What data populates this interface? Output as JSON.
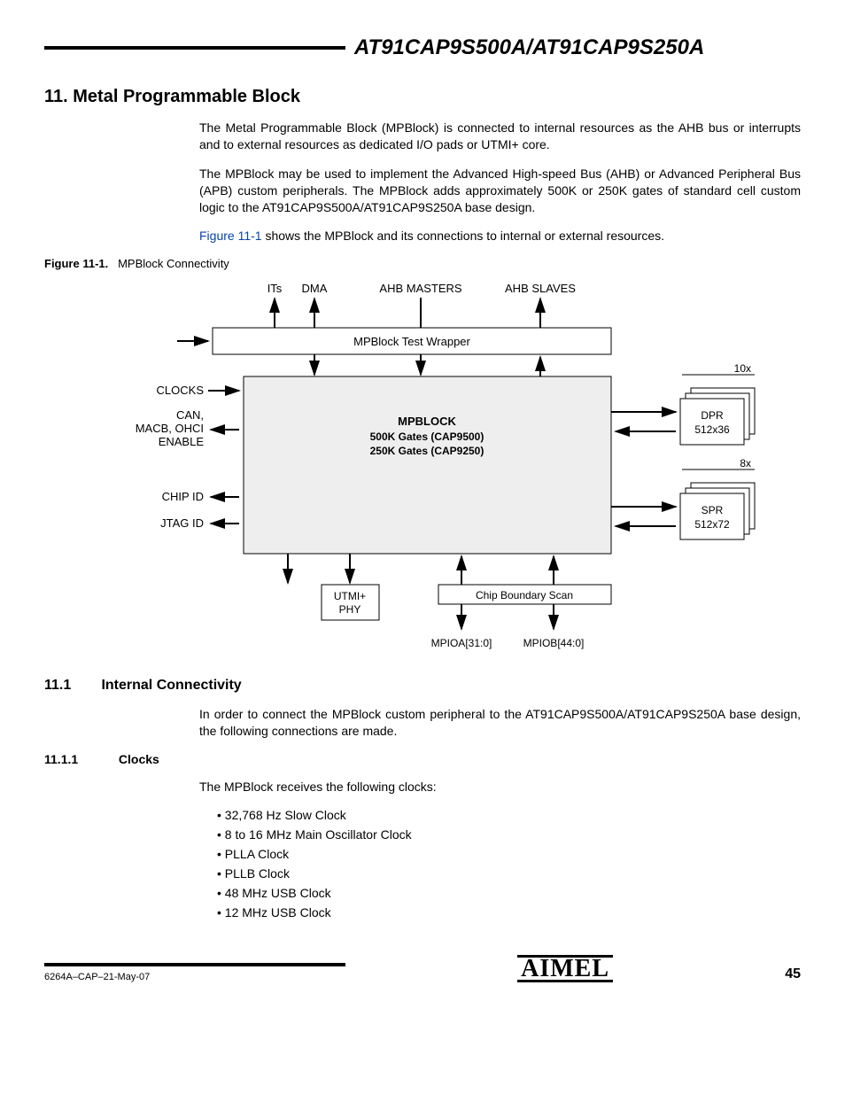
{
  "header": {
    "product": "AT91CAP9S500A/AT91CAP9S250A"
  },
  "section": {
    "number": "11.",
    "title": "Metal Programmable Block",
    "p1": "The Metal Programmable Block (MPBlock) is connected to internal resources as the AHB bus or interrupts and to external resources as dedicated I/O pads or UTMI+ core.",
    "p2": "The MPBlock may be used to implement the Advanced High-speed Bus (AHB) or Advanced Peripheral Bus (APB) custom peripherals. The MPBlock adds approximately 500K or 250K gates of standard cell custom logic to the AT91CAP9S500A/AT91CAP9S250A base design.",
    "p3_link": "Figure 11-1",
    "p3_rest": " shows the MPBlock and its connections to internal or external resources."
  },
  "figure": {
    "caption_label": "Figure 11-1.",
    "caption_text": "MPBlock Connectivity",
    "labels": {
      "its": "ITs",
      "dma": "DMA",
      "ahb_masters": "AHB MASTERS",
      "ahb_slaves": "AHB SLAVES",
      "test_wrapper": "MPBlock Test Wrapper",
      "clocks": "CLOCKS",
      "can_macb": "CAN,\nMACB, OHCI\nENABLE",
      "chip_id": "CHIP ID",
      "jtag_id": "JTAG ID",
      "mpblock_title": "MPBLOCK",
      "mpblock_l1": "500K Gates (CAP9500)",
      "mpblock_l2": "250K Gates (CAP9250)",
      "dpr_count": "10x",
      "dpr_l1": "DPR",
      "dpr_l2": "512x36",
      "spr_count": "8x",
      "spr_l1": "SPR",
      "spr_l2": "512x72",
      "utmi_l1": "UTMI+",
      "utmi_l2": "PHY",
      "cbs": "Chip Boundary Scan",
      "mpioa": "MPIOA[31:0]",
      "mpiob": "MPIOB[44:0]"
    }
  },
  "sub1": {
    "number": "11.1",
    "title": "Internal Connectivity",
    "p1": "In order to connect the MPBlock custom peripheral to the AT91CAP9S500A/AT91CAP9S250A base design, the following connections are made."
  },
  "sub11": {
    "number": "11.1.1",
    "title": "Clocks",
    "p1": "The MPBlock receives the following clocks:",
    "items": [
      "32,768 Hz Slow Clock",
      "8 to 16 MHz Main Oscillator Clock",
      "PLLA Clock",
      "PLLB Clock",
      "48 MHz USB Clock",
      "12 MHz USB Clock"
    ]
  },
  "footer": {
    "docid": "6264A–CAP–21-May-07",
    "logo": "AIMEL",
    "page": "45"
  }
}
